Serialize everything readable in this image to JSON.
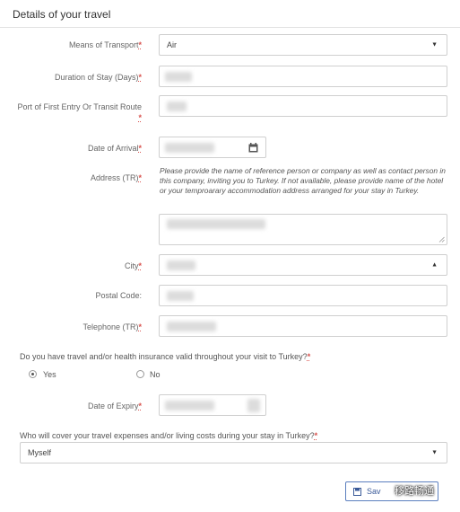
{
  "section": {
    "title": "Details of your travel"
  },
  "required_mark": "*",
  "fields": {
    "transport": {
      "label": "Means of Transport",
      "value": "Air"
    },
    "duration": {
      "label": "Duration of Stay (Days)"
    },
    "port": {
      "label_line1": "Port of First Entry Or Transit Route"
    },
    "arrival": {
      "label": "Date of Arrival"
    },
    "address": {
      "label": "Address (TR)",
      "help": "Please provide the name of reference person or company as well as contact person in this company, inviting you to Turkey. If not available, please provide name of the hotel or your temproarary accommodation address arranged for your stay in Turkey."
    },
    "city": {
      "label": "City"
    },
    "postal": {
      "label": "Postal Code:"
    },
    "telephone": {
      "label": "Telephone (TR)"
    }
  },
  "insurance": {
    "question": "Do you have travel and/or health insurance valid throughout your visit to Turkey?",
    "options": [
      "Yes",
      "No"
    ],
    "selected": "Yes"
  },
  "expiry": {
    "label": "Date of Expiry"
  },
  "expenses": {
    "question": "Who will cover your travel expenses and/or living costs during your stay in Turkey?",
    "value": "Myself"
  },
  "save_button": {
    "label": "Sav"
  },
  "watermark": {
    "text": "移路畅通"
  },
  "icons": {
    "calendar": "calendar-icon",
    "select_down": "chevron-down-icon",
    "select_up": "chevron-up-icon",
    "save": "floppy-disk-icon"
  }
}
